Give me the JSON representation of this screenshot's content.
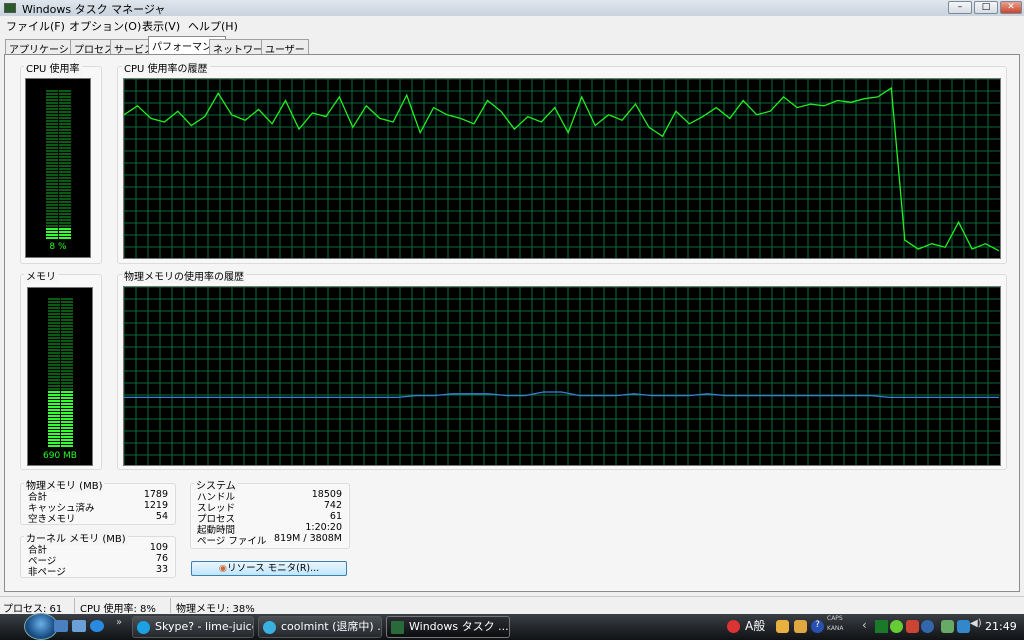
{
  "window": {
    "title": "Windows タスク マネージャ",
    "minimize": "–",
    "maximize": "□",
    "close": "✕"
  },
  "menu": [
    "ファイル(F)",
    "オプション(O)",
    "表示(V)",
    "ヘルプ(H)"
  ],
  "tabs": [
    {
      "label": "アプリケーション"
    },
    {
      "label": "プロセス"
    },
    {
      "label": "サービス"
    },
    {
      "label": "パフォーマンス",
      "active": true
    },
    {
      "label": "ネットワーク"
    },
    {
      "label": "ユーザー"
    }
  ],
  "cpu": {
    "label": "CPU 使用率",
    "value_text": "8 %",
    "percent": 8,
    "history_label": "CPU 使用率の履歴",
    "history": [
      80,
      85,
      78,
      76,
      82,
      74,
      79,
      92,
      80,
      77,
      83,
      75,
      88,
      72,
      81,
      79,
      90,
      73,
      85,
      78,
      76,
      91,
      70,
      84,
      80,
      78,
      75,
      88,
      82,
      72,
      79,
      76,
      84,
      70,
      90,
      74,
      80,
      77,
      86,
      73,
      68,
      82,
      75,
      79,
      84,
      78,
      88,
      80,
      82,
      90,
      84,
      86,
      85,
      88,
      87,
      89,
      90,
      95,
      10,
      5,
      8,
      6,
      20,
      5,
      8,
      4
    ]
  },
  "memory": {
    "label": "メモリ",
    "value_text": "690 MB",
    "percent": 38,
    "history_label": "物理メモリの使用率の履歴",
    "history": [
      38,
      38,
      38,
      38,
      38,
      38,
      38,
      38,
      38,
      38,
      38,
      38,
      38,
      38,
      38,
      38,
      39,
      39,
      40,
      40,
      40,
      39,
      39,
      41,
      41,
      39,
      39,
      39,
      40,
      39,
      39,
      39,
      40,
      39,
      39,
      39,
      39,
      39,
      39,
      39,
      39,
      39,
      38,
      38,
      38,
      38,
      38,
      38,
      38
    ]
  },
  "physical": {
    "title": "物理メモリ (MB)",
    "rows": [
      {
        "label": "合計",
        "value": "1789"
      },
      {
        "label": "キャッシュ済み",
        "value": "1219"
      },
      {
        "label": "空きメモリ",
        "value": "54"
      }
    ]
  },
  "kernel": {
    "title": "カーネル メモリ (MB)",
    "rows": [
      {
        "label": "合計",
        "value": "109"
      },
      {
        "label": "ページ",
        "value": "76"
      },
      {
        "label": "非ページ",
        "value": "33"
      }
    ]
  },
  "system": {
    "title": "システム",
    "rows": [
      {
        "label": "ハンドル",
        "value": "18509"
      },
      {
        "label": "スレッド",
        "value": "742"
      },
      {
        "label": "プロセス",
        "value": "61"
      },
      {
        "label": "起動時間",
        "value": "1:20:20"
      },
      {
        "label": "ページ ファイル",
        "value": "819M / 3808M"
      }
    ]
  },
  "resource_button": "リソース モニタ(R)...",
  "status": {
    "processes": "プロセス: 61",
    "cpu": "CPU 使用率: 8%",
    "memory": "物理メモリ: 38%"
  },
  "taskbar": {
    "items": [
      "Skype? - lime-juice",
      "coolmint (退席中) ...",
      "Windows タスク ..."
    ],
    "overflow": "»",
    "clock": "21:49",
    "ime": "A般",
    "caps": "CAPS",
    "kana": "KANA"
  },
  "colors": {
    "graph_line": "#22ee22",
    "grid": "#0a6b3a",
    "memory_line": "#3a7fd8"
  }
}
